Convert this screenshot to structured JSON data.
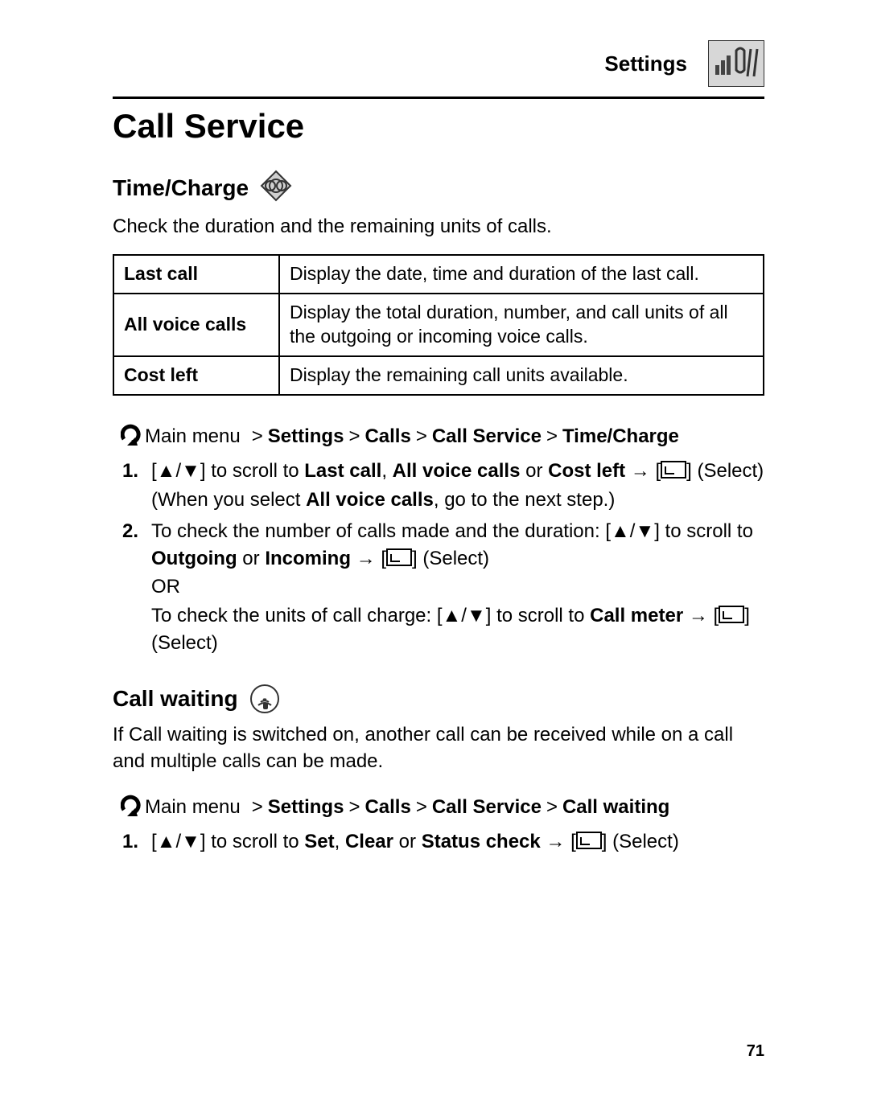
{
  "header": {
    "category": "Settings"
  },
  "page_title": "Call Service",
  "sections": {
    "time_charge": {
      "heading": "Time/Charge",
      "intro": "Check the duration and the remaining units of calls.",
      "table": [
        {
          "label": "Last call",
          "desc": "Display the date, time and duration of the last call."
        },
        {
          "label": "All voice calls",
          "desc": "Display the total duration, number, and call units of all the outgoing or incoming voice calls."
        },
        {
          "label": "Cost left",
          "desc": "Display the remaining call units available."
        }
      ],
      "breadcrumb": {
        "lead": "Main menu",
        "sep": ">",
        "parts": [
          "Settings",
          "Calls",
          "Call Service",
          "Time/Charge"
        ]
      },
      "steps": {
        "s1": {
          "num": "1.",
          "pre_icons_open": "[",
          "icons_sep": "/",
          "pre_icons_close": "]",
          "t_scroll": " to scroll to ",
          "opt1": "Last call",
          "comma": ", ",
          "opt2": "All voice calls",
          "or": " or ",
          "opt3": "Cost left",
          "arrow": " → ",
          "select": " (Select)",
          "note": "(When you select ",
          "note_bold": "All voice calls",
          "note_tail": ", go to the next step.)"
        },
        "s2": {
          "num": "2.",
          "lead": "To check the number of calls made and the duration: [",
          "t_scroll": "] to scroll to ",
          "out": "Outgoing",
          "or1": " or ",
          "inc": "Incoming",
          "arrow": " → ",
          "select": " (Select)",
          "or_word": "OR",
          "lead2": "To check the units of call charge: [",
          "t_scroll2": "] to scroll to ",
          "meter": "Call meter",
          "arrow2": " → ",
          "select2": " (Select)"
        }
      }
    },
    "call_waiting": {
      "heading": "Call waiting",
      "intro": "If Call waiting is switched on, another call can be received while on a call and multiple calls can be made.",
      "breadcrumb": {
        "lead": "Main menu",
        "sep": ">",
        "parts": [
          "Settings",
          "Calls",
          "Call Service",
          "Call waiting"
        ]
      },
      "step": {
        "num": "1.",
        "open": "[",
        "mid": "] to scroll to ",
        "o1": "Set",
        "c1": ", ",
        "o2": "Clear",
        "or": " or ",
        "o3": "Status check",
        "arrow": " → ",
        "select": " (Select)"
      }
    }
  },
  "page_number": "71"
}
